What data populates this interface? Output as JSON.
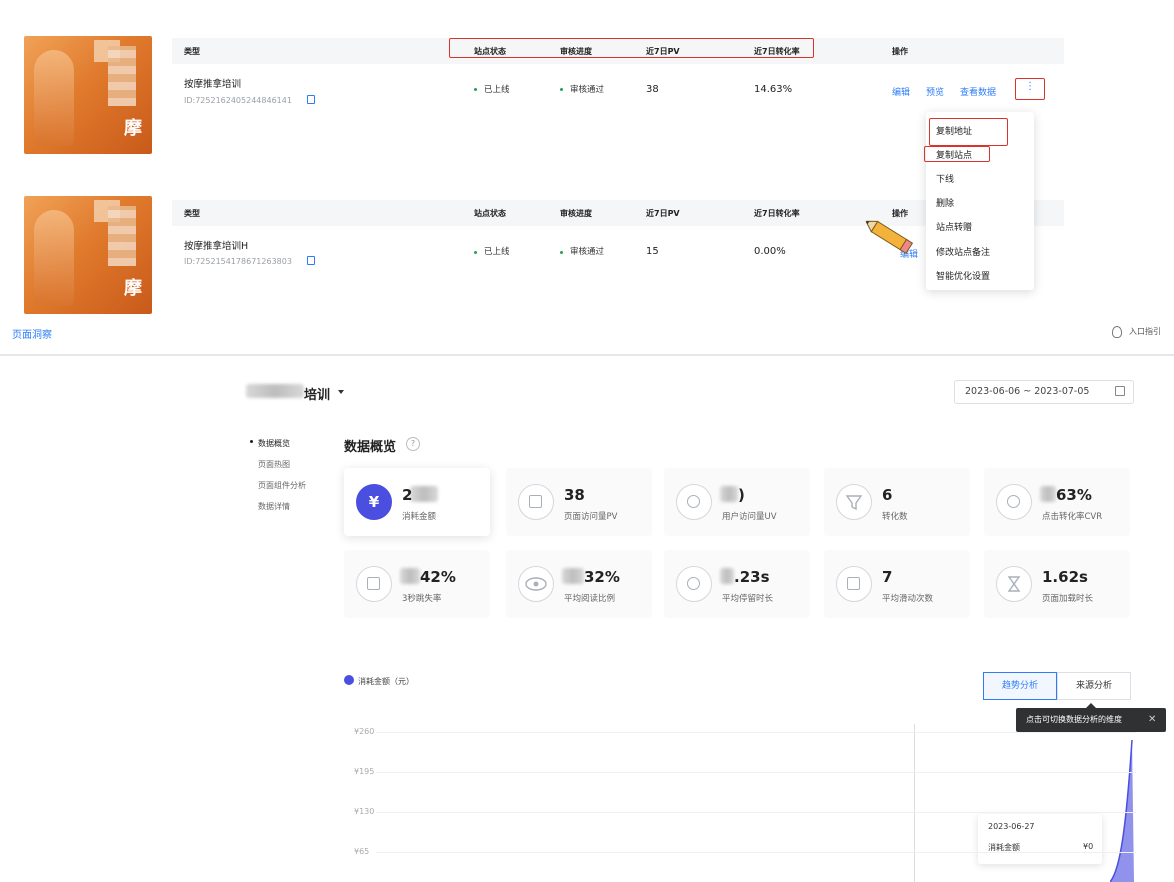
{
  "columns": {
    "type": "类型",
    "site_status": "站点状态",
    "review_progress": "审核进度",
    "pv_7d": "近7日PV",
    "cvr_7d": "近7日转化率",
    "actions": "操作"
  },
  "sites": [
    {
      "name": "按摩推拿培训",
      "id": "ID:7252162405244846141",
      "status": "已上线",
      "review": "审核通过",
      "pv": "38",
      "cvr": "14.63%"
    },
    {
      "name": "按摩推拿培训H",
      "id": "ID:7252154178671263803",
      "status": "已上线",
      "review": "审核通过",
      "pv": "15",
      "cvr": "0.00%"
    }
  ],
  "thumb_glyphs": [
    "摩",
    "摩"
  ],
  "action_links": {
    "edit": "编辑",
    "preview": "预览",
    "view_data": "查看数据",
    "more": "⋮",
    "edit_partial": "编辑"
  },
  "more_menu": [
    "复制地址",
    "复制站点",
    "下线",
    "删除",
    "站点转赠",
    "修改站点备注",
    "智能优化设置"
  ],
  "footer": {
    "left_link": "页面洞察",
    "entry_guide": "入口指引"
  },
  "report": {
    "site_title": "培训",
    "date_range": "2023-06-06 ~ 2023-07-05",
    "nav": [
      "数据概览",
      "页面热图",
      "页面组件分析",
      "数据详情"
    ],
    "section_title": "数据概览",
    "help": "?",
    "metrics": [
      {
        "value": "2",
        "label": "消耗金额",
        "icon": "yuan-icon"
      },
      {
        "value": "38",
        "label": "页面访问量PV",
        "icon": "page-view-icon"
      },
      {
        "value": ")",
        "label": "用户访问量UV",
        "icon": "user-icon"
      },
      {
        "value": "6",
        "label": "转化数",
        "icon": "funnel-icon"
      },
      {
        "value": "63%",
        "label": "点击转化率CVR",
        "icon": "click-icon"
      },
      {
        "value": "42%",
        "label": "3秒跳失率",
        "icon": "bounce-icon"
      },
      {
        "value": "32%",
        "label": "平均阅读比例",
        "icon": "eye-icon"
      },
      {
        "value": ".23s",
        "label": "平均停留时长",
        "icon": "stopwatch-icon"
      },
      {
        "value": "7",
        "label": "平均滑动次数",
        "icon": "scroll-icon"
      },
      {
        "value": "1.62s",
        "label": "页面加载时长",
        "icon": "hourglass-icon"
      }
    ],
    "yuan_symbol": "¥",
    "legend": "消耗金额（元）",
    "tabs": [
      "趋势分析",
      "来源分析"
    ],
    "tooltip": "点击可切换数据分析的维度",
    "tooltip_close": "✕",
    "hover": {
      "date": "2023-06-27",
      "label": "消耗金额",
      "value": "¥0"
    }
  },
  "chart_data": {
    "type": "area",
    "yticks": [
      "¥260",
      "¥195",
      "¥130",
      "¥65"
    ],
    "ylim": [
      0,
      260
    ],
    "series": [
      {
        "name": "消耗金额（元）",
        "color": "#4a4fe0"
      }
    ]
  },
  "colors": {
    "accent": "#2f7df6",
    "metric_blue": "#4a4fe0",
    "highlight_red": "#d9342b",
    "status_green": "#21a453"
  }
}
